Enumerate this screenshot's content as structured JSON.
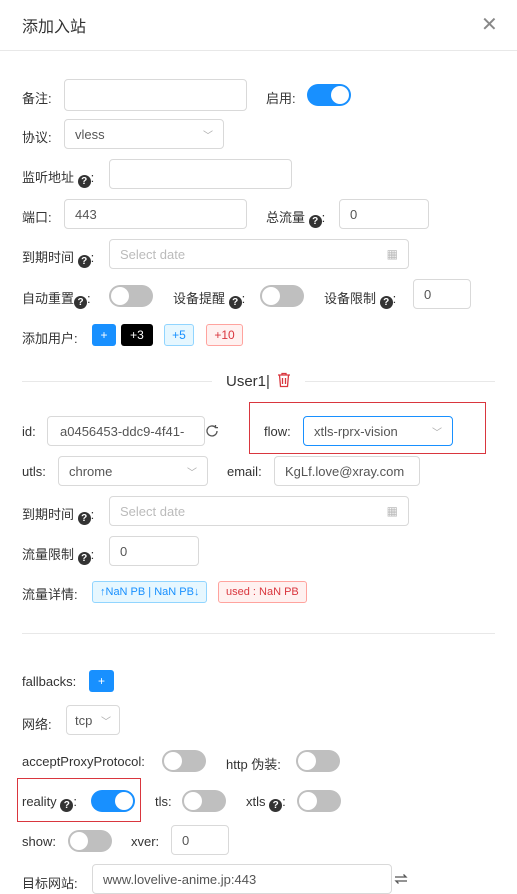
{
  "dialog": {
    "title": "添加入站",
    "close_glyph": "✕"
  },
  "form": {
    "remark_label": "备注:",
    "enable_label": "启用:",
    "enable_on": true,
    "protocol_label": "协议:",
    "protocol_value": "vless",
    "listen_label": "监听地址",
    "port_label": "端口:",
    "port_value": "443",
    "total_traffic_label": "总流量",
    "total_traffic_value": "0",
    "expiry_label": "到期时间",
    "expiry_placeholder": "Select date",
    "auto_reset_label": "自动重置",
    "auto_reset_on": false,
    "device_alert_label": "设备提醒",
    "device_alert_on": false,
    "device_limit_label": "设备限制",
    "device_limit_value": "0",
    "add_user_label": "添加用户:",
    "add_buttons": [
      "+",
      "+3",
      "+5",
      "+10"
    ]
  },
  "user": {
    "heading": "User1|",
    "id_label": "id:",
    "id_value": "a0456453-ddc9-4f41-",
    "flow_label": "flow:",
    "flow_value": "xtls-rprx-vision",
    "utls_label": "utls:",
    "utls_value": "chrome",
    "email_label": "email:",
    "email_value": "KgLf.love@xray.com",
    "expiry_label": "到期时间",
    "expiry_placeholder": "Select date",
    "traffic_limit_label": "流量限制",
    "traffic_limit_value": "0",
    "traffic_detail_label": "流量详情:",
    "traffic_up_down": "↑NaN PB | NaN PB↓",
    "traffic_used": "used : NaN PB"
  },
  "stream": {
    "fallbacks_label": "fallbacks:",
    "fallbacks_add": "+",
    "network_label": "网络:",
    "network_value": "tcp",
    "accept_proxy_label": "acceptProxyProtocol:",
    "accept_proxy_on": false,
    "http_disguise_label": "http 伪装:",
    "http_disguise_on": false,
    "reality_label": "reality",
    "reality_on": true,
    "tls_label": "tls:",
    "tls_on": false,
    "xtls_label": "xtls",
    "xtls_on": false,
    "show_label": "show:",
    "show_on": false,
    "xver_label": "xver:",
    "xver_value": "0",
    "target_label": "目标网站:",
    "target_value": "www.lovelive-anime.jp:443"
  },
  "icons": {
    "question": "question-icon",
    "calendar": "calendar-icon",
    "refresh": "refresh-icon",
    "delete": "trash-icon",
    "swap": "swap-icon",
    "chevron": "chevron-down-icon"
  },
  "colors": {
    "primary": "#1890ff",
    "danger": "#d9363e",
    "black_button": "#000000"
  }
}
